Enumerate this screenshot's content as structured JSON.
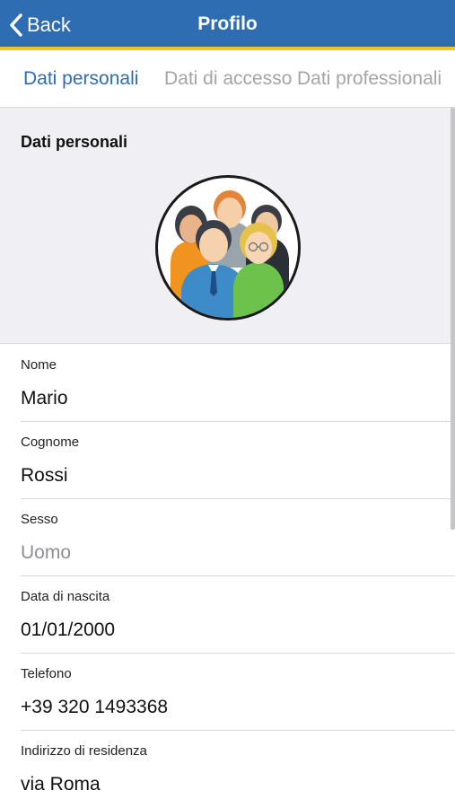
{
  "navbar": {
    "back_label": "Back",
    "title": "Profilo",
    "color": "#2f6db3",
    "accent": "#f2c318"
  },
  "tabs": [
    {
      "label": "Dati personali",
      "active": true
    },
    {
      "label": "Dati di accesso",
      "active": false
    },
    {
      "label": "Dati professionali",
      "active": false
    }
  ],
  "section": {
    "title": "Dati personali",
    "avatar_icon": "group-people-icon"
  },
  "fields": [
    {
      "label": "Nome",
      "value": "Mario"
    },
    {
      "label": "Cognome",
      "value": "Rossi"
    },
    {
      "label": "Sesso",
      "value": "Uomo"
    },
    {
      "label": "Data di nascita",
      "value": "01/01/2000"
    },
    {
      "label": "Telefono",
      "value": "+39 320 1493368"
    },
    {
      "label": "Indirizzo di residenza",
      "value": "via Roma"
    }
  ]
}
